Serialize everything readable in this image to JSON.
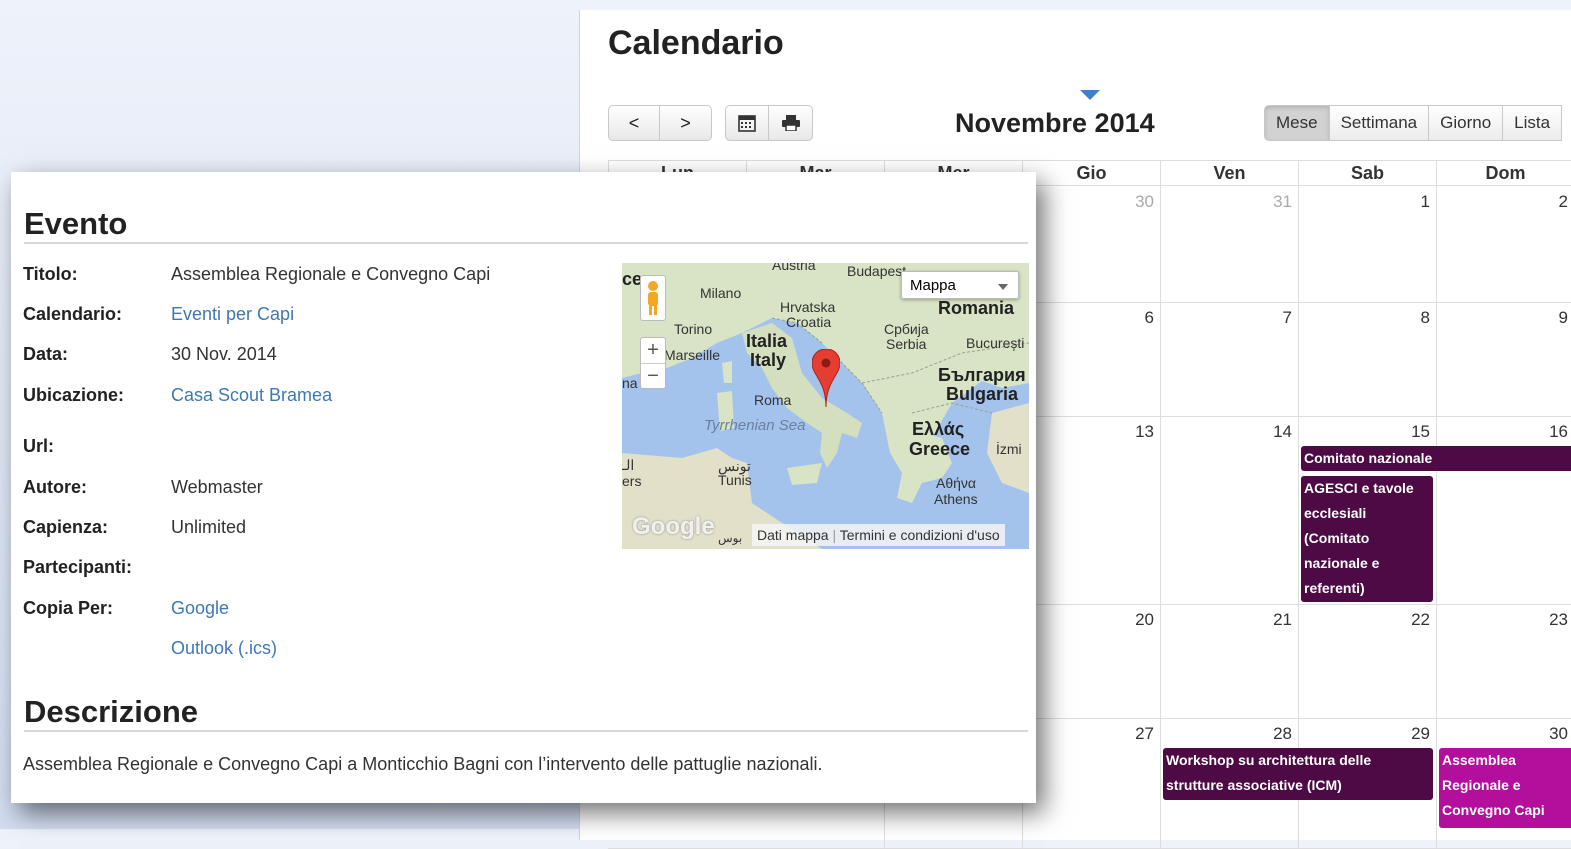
{
  "calendar": {
    "title": "Calendario",
    "month_title": "Novembre 2014",
    "nav": {
      "prev": "<",
      "next": ">"
    },
    "views": [
      "Mese",
      "Settimana",
      "Giorno",
      "Lista"
    ],
    "weekdays": [
      "Lun",
      "Mar",
      "Mer",
      "Gio",
      "Ven",
      "Sab",
      "Dom"
    ],
    "weeks": [
      {
        "days": [
          "",
          "",
          "",
          "30",
          "31",
          "1",
          "2"
        ]
      },
      {
        "days": [
          "",
          "",
          "",
          "6",
          "7",
          "8",
          "9"
        ]
      },
      {
        "days": [
          "",
          "",
          "",
          "13",
          "14",
          "15",
          "16"
        ]
      },
      {
        "days": [
          "",
          "",
          "",
          "20",
          "21",
          "22",
          "23"
        ]
      },
      {
        "days": [
          "",
          "",
          "",
          "27",
          "28",
          "29",
          "30"
        ]
      }
    ],
    "events": {
      "comitato": "Comitato nazionale",
      "agesci": "AGESCI e tavole ecclesiali (Comitato nazionale e referenti)",
      "workshop": "Workshop su architettura delle strutture associative (ICM)",
      "assemblea": "Assemblea Regionale e Convegno Capi"
    },
    "colors": {
      "event_dark": "#4d0a45",
      "event_pink": "#b30e9c"
    }
  },
  "popup": {
    "heading": "Evento",
    "fields": {
      "titolo_label": "Titolo:",
      "titolo_value": "Assemblea Regionale e Convegno Capi",
      "calendario_label": "Calendario:",
      "calendario_value": "Eventi per Capi",
      "data_label": "Data:",
      "data_value": "30 Nov. 2014",
      "ubicazione_label": "Ubicazione:",
      "ubicazione_value": "Casa Scout Bramea",
      "url_label": "Url:",
      "autore_label": "Autore:",
      "autore_value": "Webmaster",
      "capienza_label": "Capienza:",
      "capienza_value": "Unlimited",
      "partecipanti_label": "Partecipanti:",
      "copia_label": "Copia Per:",
      "copia_google": "Google",
      "copia_outlook": "Outlook (.ics)"
    },
    "description_heading": "Descrizione",
    "description": "Assemblea Regionale e Convegno Capi a Monticchio Bagni con l’intervento delle pattuglie nazionali.",
    "map": {
      "type_selector": "Mappa",
      "zoom_in": "+",
      "zoom_out": "−",
      "labels": {
        "austria": "Austria",
        "budapest": "Budapest",
        "milano": "Milano",
        "hrvatska": "Hrvatska",
        "croatia": "Croatia",
        "romania": "Romania",
        "torino": "Torino",
        "srbija": "Србија",
        "serbia": "Serbia",
        "bucuresti": "București",
        "marseille": "Marseille",
        "italia": "Italia",
        "italy": "Italy",
        "bulgaria_local": "България",
        "bulgaria": "Bulgaria",
        "roma": "Roma",
        "tyrrhenian": "Tyrrhenian Sea",
        "greece_local": "Ελλάς",
        "greece": "Greece",
        "izmir": "İzmi",
        "tunis_local": "تونس",
        "tunis": "Tunis",
        "athens_local": "Αθήνα",
        "athens": "Athens",
        "left_edge_1": "الـ",
        "left_edge_2": "ers",
        "left_edge_3": "ce",
        "left_edge_4": "na",
        "google": "Google",
        "google_ar": "بوس"
      },
      "footer_data": "Dati mappa",
      "footer_terms": "Termini e condizioni d'uso"
    }
  }
}
